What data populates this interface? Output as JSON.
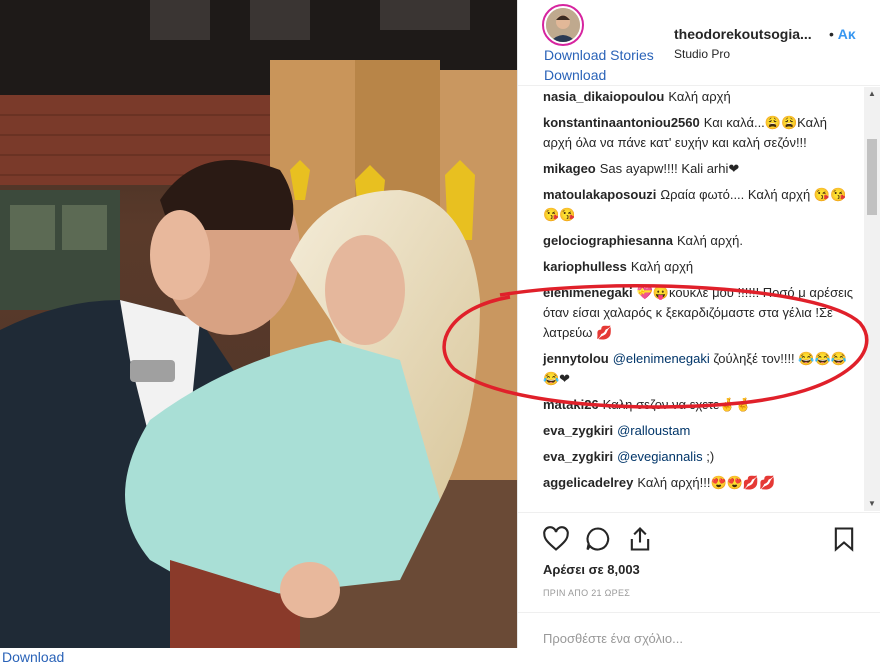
{
  "window": {
    "bottom_download": "Download"
  },
  "header": {
    "username": "theodorekoutsogia...",
    "dot": "•",
    "follow": "Ακ",
    "sublabel": "Studio Pro",
    "download_stories": "Download Stories",
    "download": "Download"
  },
  "comments": [
    {
      "user": "nasia_dikaiopoulou",
      "text": "Καλή αρχή"
    },
    {
      "user": "konstantinaantoniou2560",
      "text": "Και καλά...😩😩Καλή αρχή όλα να πάνε κατ' ευχήν και καλή σεζόν!!!"
    },
    {
      "user": "mikageo",
      "text": "Sas ayapw!!!! Kali arhi❤"
    },
    {
      "user": "matoulakaposouzi",
      "text": "Ωραία φωτό.... Καλή αρχή 😘😘😘😘"
    },
    {
      "user": "gelociographiesanna",
      "text": "Καλή αρχή."
    },
    {
      "user": "kariophulless",
      "text": "Καλή αρχή"
    },
    {
      "user": "elenimenegaki",
      "text": "💝😛κουκλε μου !!!!!! Ποσό μ αρέσεις όταν είσαι χαλαρός κ ξεκαρδιζόμαστε στα γέλια !Σε λατρεύω 💋"
    },
    {
      "user": "jennytolou",
      "mention": "@elenimenegaki",
      "text": "ζούληξέ τον!!!! 😂😂😂😂❤"
    },
    {
      "user": "mataki26",
      "text": "Καλη σεζον να εχετε🤞🤞"
    },
    {
      "user": "eva_zygkiri",
      "mention": "@ralloustam",
      "text": ""
    },
    {
      "user": "eva_zygkiri",
      "mention": "@evegiannalis",
      "text": ";)"
    },
    {
      "user": "aggelicadelrey",
      "text": "Καλή αρχή!!!😍😍💋💋"
    }
  ],
  "icons": {
    "like": "heart-icon",
    "comment": "comment-icon",
    "share": "share-icon",
    "save": "bookmark-icon"
  },
  "likes": "Αρέσει σε 8,003",
  "time": "ΠΡΙΝ ΑΠΟ 21 ΩΡΕΣ",
  "add_comment": {
    "placeholder": "Προσθέστε ένα σχόλιο..."
  },
  "colors": {
    "link": "#2a63b8",
    "annotation": "#e0202a",
    "mention": "#003569"
  }
}
